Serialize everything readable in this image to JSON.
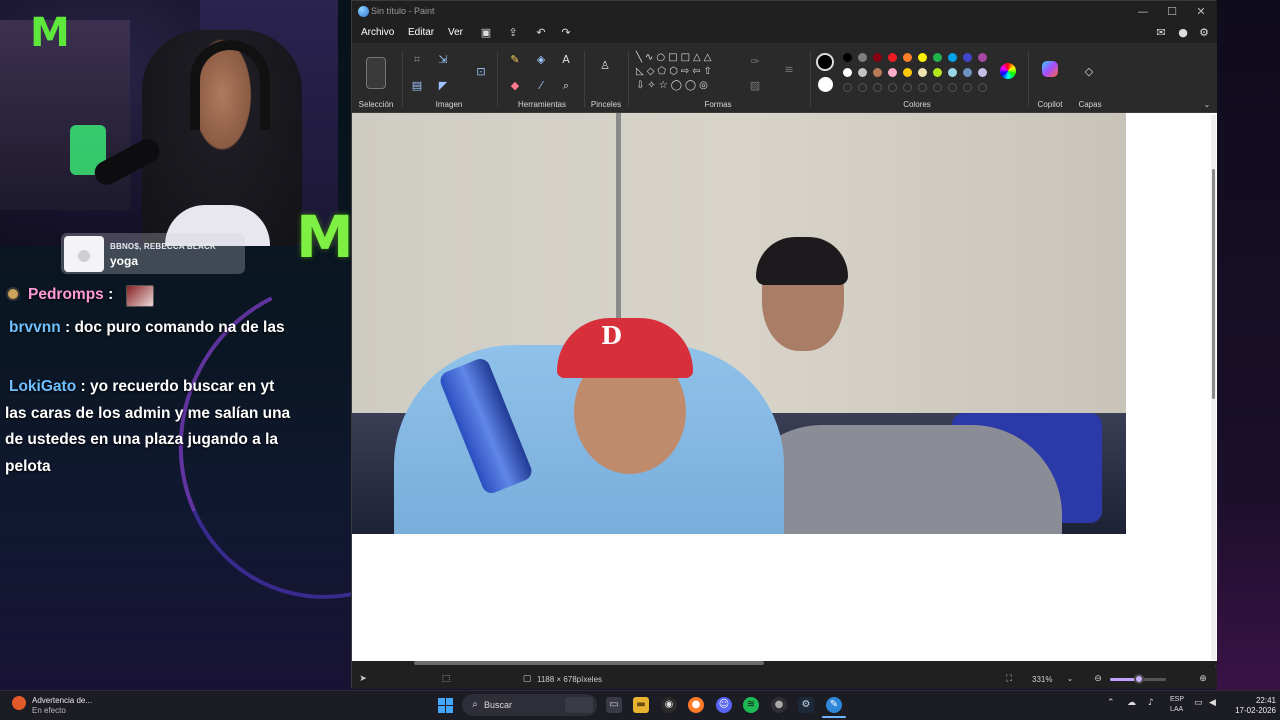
{
  "stream": {
    "alert": {
      "names": "BBNO$, REBECCA BLACK",
      "message": "yoga"
    },
    "chat": [
      {
        "user": "Pedromps",
        "separator": " :",
        "text": "",
        "emote": true
      },
      {
        "user": "brvvnn",
        "separator": " :",
        "text": " doc puro comando na de las"
      },
      {
        "user": "LokiGato",
        "separator": " :",
        "text": " yo recuerdo buscar en yt las caras de los admin y me salían una de ustedes en una plaza jugando a la pelota"
      }
    ]
  },
  "paint": {
    "title": "Sin título - Paint",
    "window_buttons": {
      "minimize": "—",
      "maximize": "☐",
      "close": "✕"
    },
    "menu": {
      "file": "Archivo",
      "edit": "Editar",
      "view": "Ver"
    },
    "ribbon_groups": {
      "selection": "Selección",
      "image": "Imagen",
      "tools": "Herramientas",
      "brushes": "Pinceles",
      "shapes": "Formas",
      "colors": "Colores",
      "copilot": "Copilot",
      "layers": "Capas"
    },
    "palette_row1": [
      "#000000",
      "#7f7f7f",
      "#880015",
      "#ed1c24",
      "#ff7f27",
      "#fff200",
      "#22b14c",
      "#00a2e8",
      "#3f48cc",
      "#a349a4"
    ],
    "palette_row2": [
      "#ffffff",
      "#c3c3c3",
      "#b97a57",
      "#ffaec9",
      "#ffc90e",
      "#efe4b0",
      "#b5e61d",
      "#99d9ea",
      "#7092be",
      "#c8bfe7"
    ],
    "status": {
      "size": "1188 × 678píxeles",
      "zoom": "331%",
      "zoom_fraction": 0.45
    }
  },
  "taskbar": {
    "notification_title": "Advertencia de...",
    "notification_sub": "En efecto",
    "search": "Buscar",
    "lang_top": "ESP",
    "lang_bottom": "LAA",
    "time": "22:41",
    "date": "17-02-2026"
  }
}
